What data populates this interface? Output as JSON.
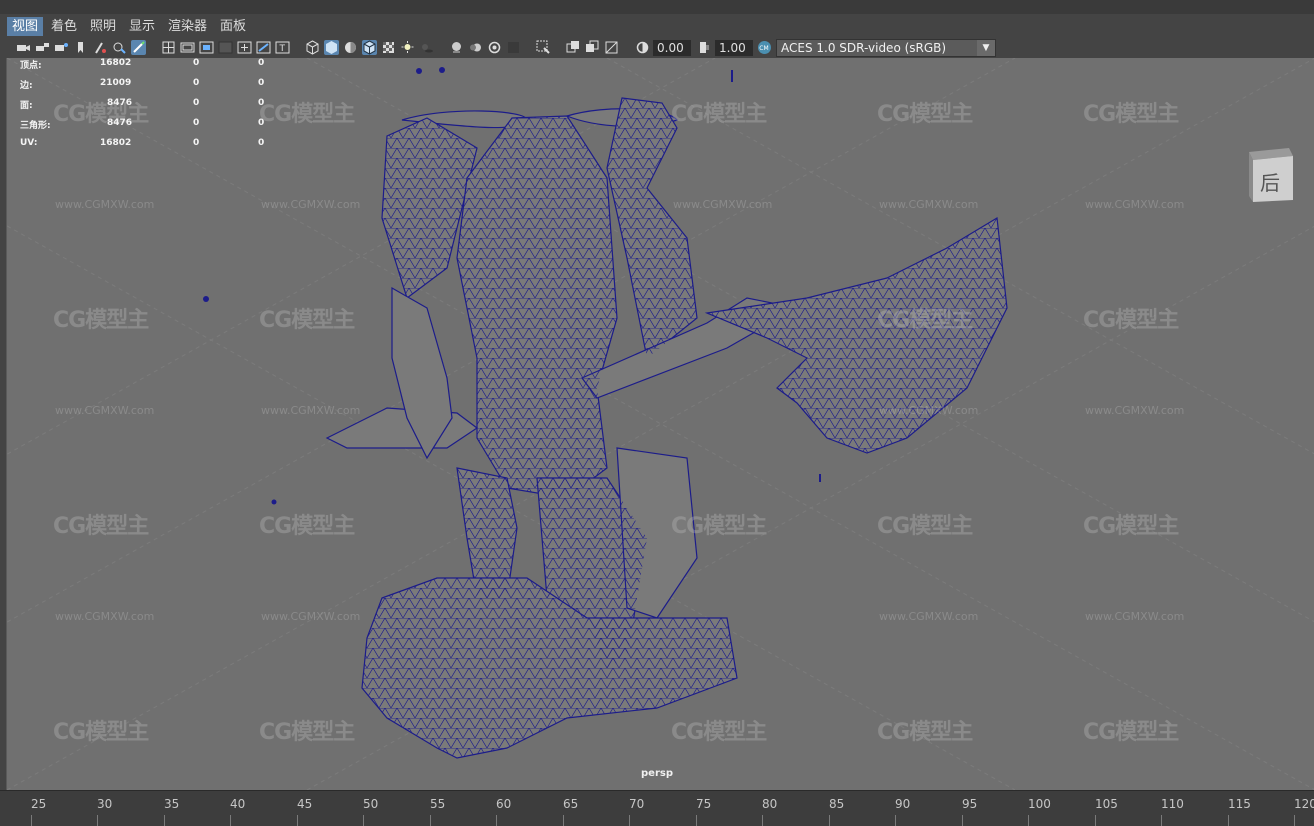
{
  "menubar": {
    "items": [
      "视图",
      "着色",
      "照明",
      "显示",
      "渲染器",
      "面板"
    ],
    "active": "视图"
  },
  "toolbar": {
    "exposure_value": "0.00",
    "gamma_value": "1.00",
    "color_space": "ACES 1.0 SDR-video (sRGB)"
  },
  "stats": {
    "rows": [
      {
        "label": "顶点:",
        "value": "16802",
        "sel": "0",
        "extra": "0"
      },
      {
        "label": "边:",
        "value": "21009",
        "sel": "0",
        "extra": "0"
      },
      {
        "label": "面:",
        "value": "8476",
        "sel": "0",
        "extra": "0"
      },
      {
        "label": "三角形:",
        "value": "8476",
        "sel": "0",
        "extra": "0"
      },
      {
        "label": "UV:",
        "value": "16802",
        "sel": "0",
        "extra": "0"
      }
    ]
  },
  "viewport": {
    "camera_label": "persp",
    "view_cube_label": "后",
    "watermark": "CG模型主",
    "watermark_url": "www.CGMXW.com"
  },
  "timeline": {
    "ticks": [
      "25",
      "30",
      "35",
      "40",
      "45",
      "50",
      "55",
      "60",
      "65",
      "70",
      "75",
      "80",
      "85",
      "90",
      "95",
      "100",
      "105",
      "110",
      "115",
      "120"
    ]
  },
  "colors": {
    "viewport_bg": "#707070",
    "wireframe": "#1c1c8a",
    "active_menu": "#5a7fa6"
  }
}
